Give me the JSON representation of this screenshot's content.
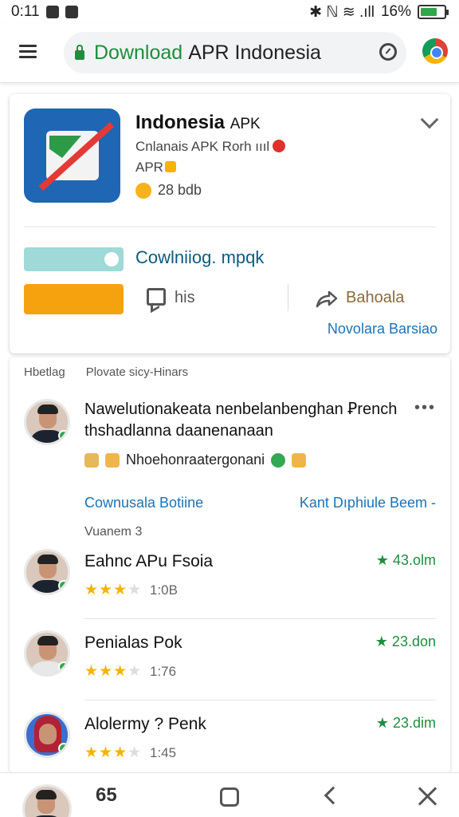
{
  "status": {
    "time": "0:11",
    "right_text": "✱ ℕ ≋ .ıll",
    "battery": "16%",
    "battery_level": 0.16
  },
  "browser": {
    "url_prefix": "Download",
    "url_rest": "APR Indonesia"
  },
  "app": {
    "title": "Indonesia",
    "title_suffix": "APK",
    "line1": "Cnlanais APK Rorh ıııl",
    "line2": "APR",
    "rating": "28 bdb",
    "download_text": "Cowlniiog. mpqk",
    "download_progress": 0.8,
    "action_left": "his",
    "action_right": "Bahoala",
    "more_link": "Novolara Barsiao"
  },
  "reviews": {
    "header_left": "Hbetlag",
    "header_right": "Plovate sicy-Hinars",
    "main_text": "Nawelutionakeata nenbelanbenghan Ꝑrench thshadlanna daanenanaan",
    "emoji_line": "Nhoehonraatergonani",
    "link_left": "Cownusala Botiine",
    "link_right": "Kant Dıphiule Beem -",
    "count": "Vuanem 3",
    "items": [
      {
        "name": "Eahnc APu Fsoia",
        "stars": "★★★",
        "stars_empty": "★",
        "time": "1:0B",
        "score": "★ 43.olm",
        "rating": 3
      },
      {
        "name": "Penialas Pok",
        "stars": "★★★",
        "stars_empty": "★",
        "time": "1:76",
        "score": "★ 23.don",
        "rating": 3
      },
      {
        "name": "Alolermy ? Penk",
        "stars": "★★★",
        "stars_empty": "★",
        "time": "1:45",
        "score": "★ 23.dim",
        "rating": 3
      }
    ]
  },
  "bottom": {
    "count": "65"
  },
  "colors": {
    "accent_green": "#1e8e3e",
    "link_blue": "#1a73b8",
    "star": "#f4b400",
    "orange": "#f6a10e",
    "app_blue": "#1f66b4"
  }
}
